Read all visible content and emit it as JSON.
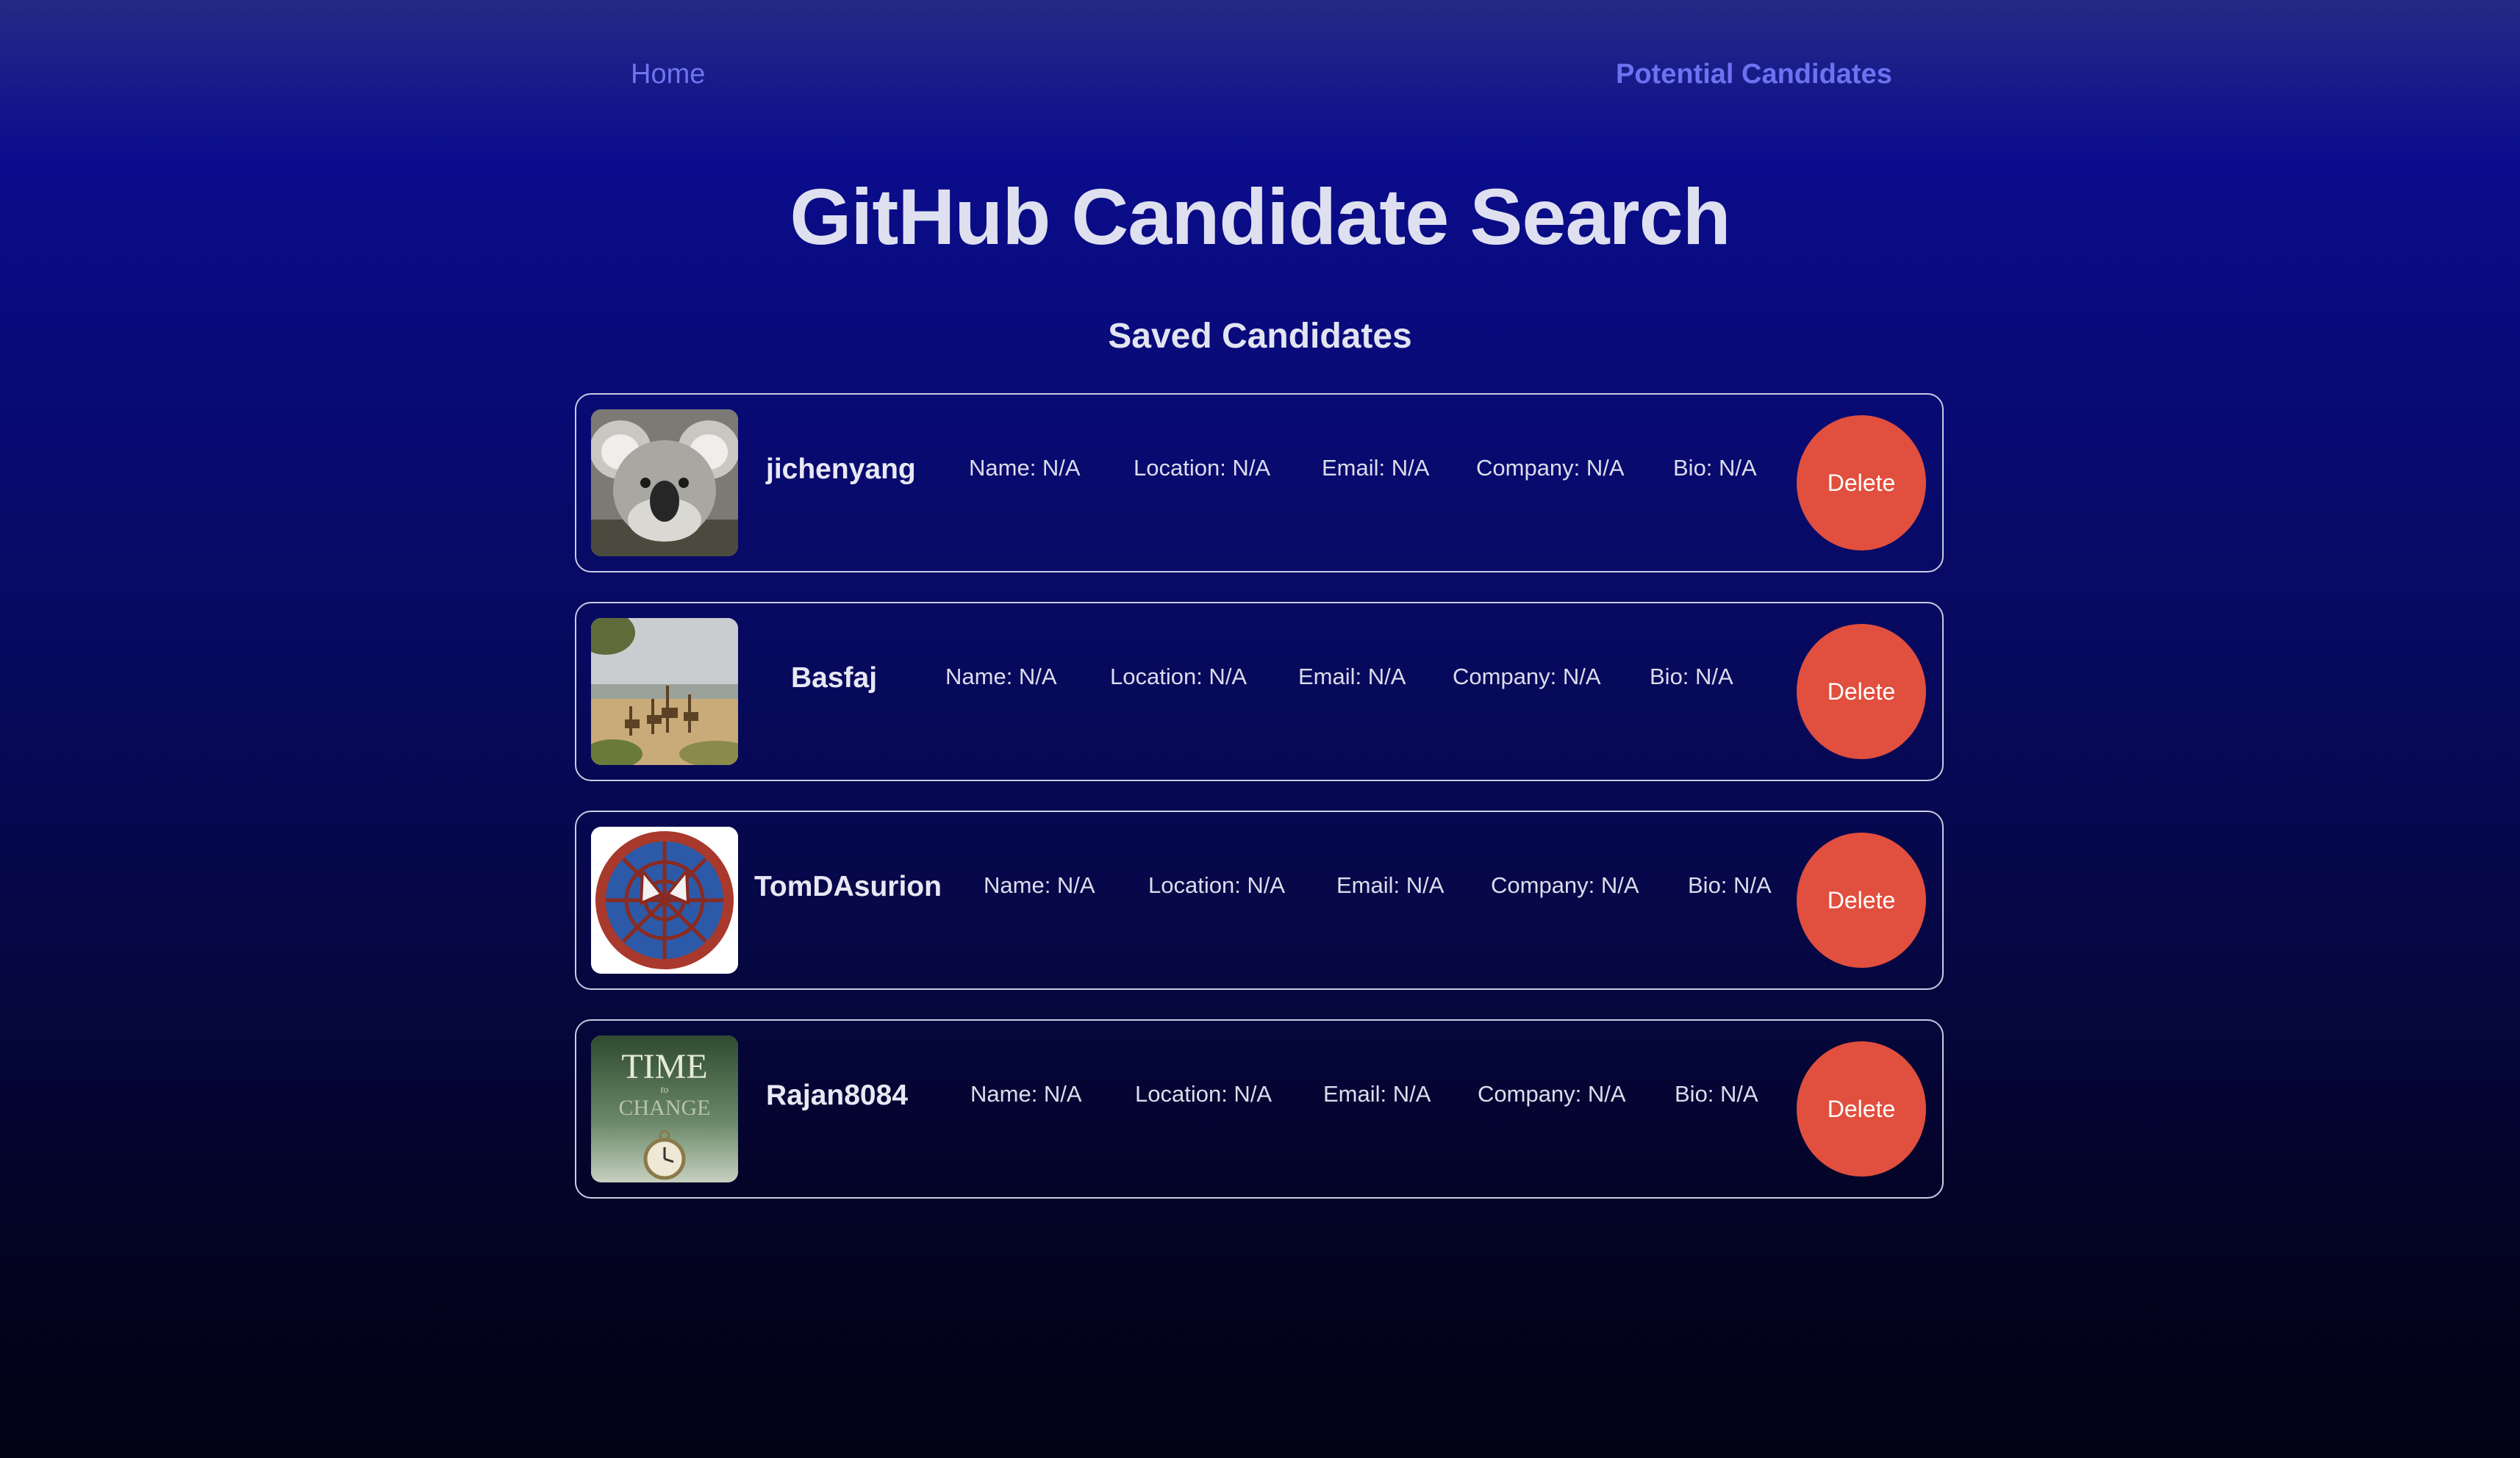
{
  "nav": {
    "home_label": "Home",
    "potential_label": "Potential Candidates"
  },
  "header": {
    "title": "GitHub Candidate Search",
    "subtitle": "Saved Candidates"
  },
  "candidates": [
    {
      "username": "jichenyang",
      "avatar_icon": "koala-avatar",
      "name": "Name: N/A",
      "location": "Location: N/A",
      "email": "Email: N/A",
      "company": "Company: N/A",
      "bio": "Bio: N/A",
      "delete_label": "Delete"
    },
    {
      "username": "Basfaj",
      "avatar_icon": "giraffes-avatar",
      "name": "Name: N/A",
      "location": "Location: N/A",
      "email": "Email: N/A",
      "company": "Company: N/A",
      "bio": "Bio: N/A",
      "delete_label": "Delete"
    },
    {
      "username": "TomDAsurion",
      "avatar_icon": "spider-emblem-avatar",
      "name": "Name: N/A",
      "location": "Location: N/A",
      "email": "Email: N/A",
      "company": "Company: N/A",
      "bio": "Bio: N/A",
      "delete_label": "Delete"
    },
    {
      "username": "Rajan8084",
      "avatar_icon": "book-cover-avatar",
      "avatar_text": [
        "TIME",
        "to",
        "CHANGE"
      ],
      "name": "Name: N/A",
      "location": "Location: N/A",
      "email": "Email: N/A",
      "company": "Company: N/A",
      "bio": "Bio: N/A",
      "delete_label": "Delete"
    }
  ],
  "colors": {
    "delete_button": "#e14f3e",
    "nav_link": "#6f74f0",
    "card_border": "#c9cbe3"
  }
}
